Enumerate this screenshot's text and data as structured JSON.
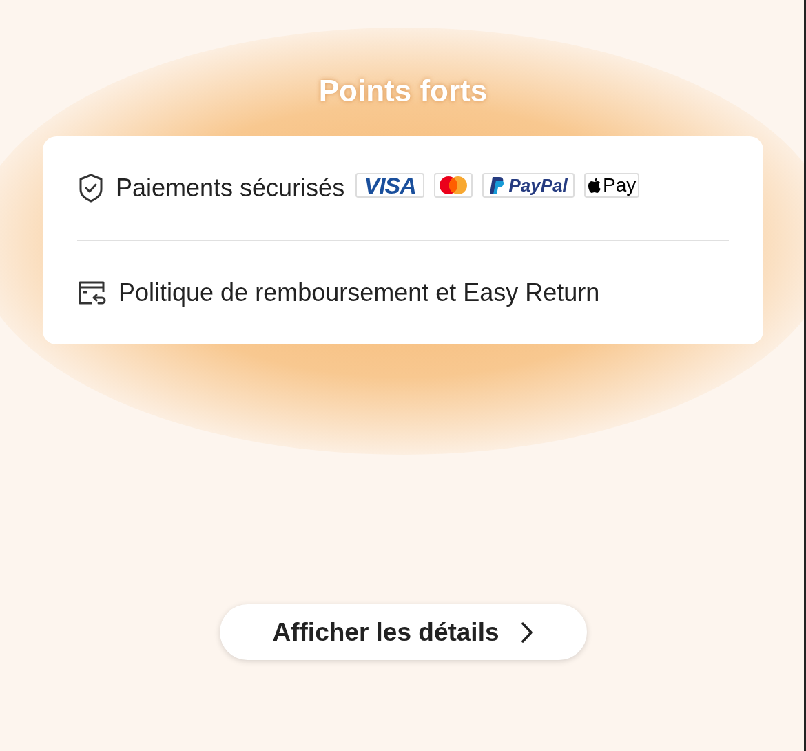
{
  "title": "Points forts",
  "features": [
    {
      "kind": "payments",
      "label": "Paiements sécurisés",
      "payment_methods": [
        {
          "kind": "visa",
          "text": "VISA"
        },
        {
          "kind": "mastercard"
        },
        {
          "kind": "paypal",
          "text": "PayPal"
        },
        {
          "kind": "applepay",
          "text": "Pay"
        }
      ]
    },
    {
      "kind": "refund",
      "label": "Politique de remboursement et Easy Return"
    }
  ],
  "details_button": {
    "label": "Afficher les détails"
  }
}
